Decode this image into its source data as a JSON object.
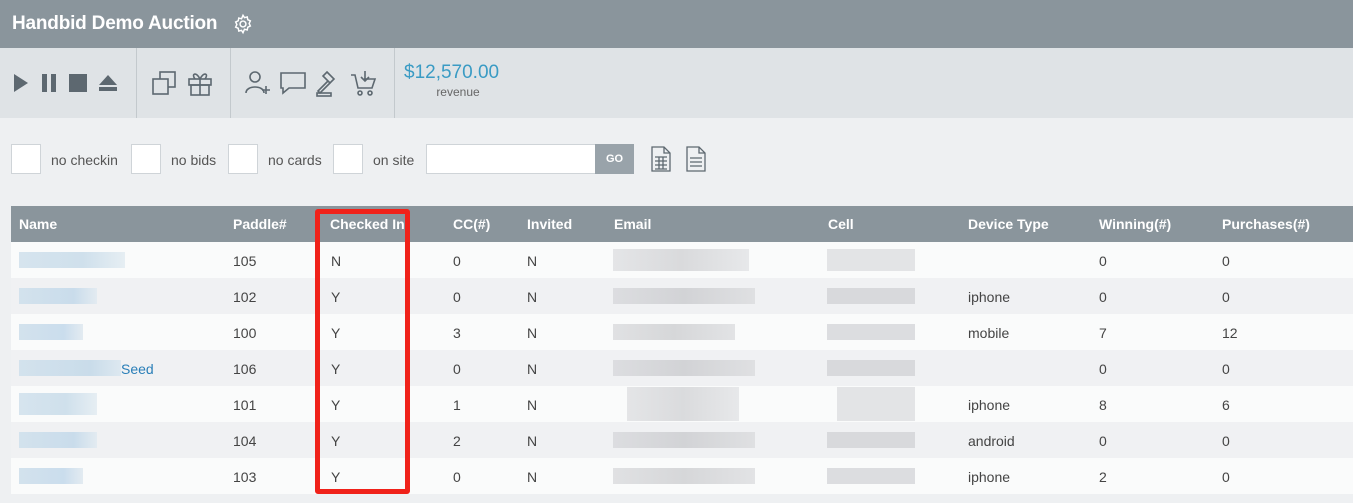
{
  "app": {
    "title": "Handbid Demo Auction",
    "title_icon": "gear-icon"
  },
  "toolbar": {
    "playback_icons": [
      "play-icon",
      "pause-icon",
      "stop-icon",
      "eject-icon"
    ],
    "item_icons": [
      "copy-icon",
      "gift-icon"
    ],
    "action_icons": [
      "add-user-icon",
      "chat-icon",
      "gavel-icon",
      "cart-download-icon"
    ],
    "revenue_amount": "$12,570.00",
    "revenue_label": "revenue",
    "accent_color": "#3a9bc4"
  },
  "filters": {
    "no_checkin": "no checkin",
    "no_bids": "no bids",
    "no_cards": "no cards",
    "on_site": "on site",
    "search_value": "",
    "go_label": "GO",
    "export_icons": [
      "spreadsheet-icon",
      "document-icon"
    ]
  },
  "table": {
    "columns": [
      "Name",
      "Paddle#",
      "Checked In",
      "CC(#)",
      "Invited",
      "Email",
      "Cell",
      "Device Type",
      "Winning(#)",
      "Purchases(#)"
    ],
    "rows": [
      {
        "name_suffix": "",
        "paddle": "105",
        "checked_in": "N",
        "cc": "0",
        "invited": "N",
        "device": "",
        "winning": "0",
        "purchases": "0"
      },
      {
        "name_suffix": "",
        "paddle": "102",
        "checked_in": "Y",
        "cc": "0",
        "invited": "N",
        "device": "iphone",
        "winning": "0",
        "purchases": "0"
      },
      {
        "name_suffix": "",
        "paddle": "100",
        "checked_in": "Y",
        "cc": "3",
        "invited": "N",
        "device": "mobile",
        "winning": "7",
        "purchases": "12"
      },
      {
        "name_suffix": "Seed",
        "paddle": "106",
        "checked_in": "Y",
        "cc": "0",
        "invited": "N",
        "device": "",
        "winning": "0",
        "purchases": "0"
      },
      {
        "name_suffix": "",
        "paddle": "101",
        "checked_in": "Y",
        "cc": "1",
        "invited": "N",
        "device": "iphone",
        "winning": "8",
        "purchases": "6"
      },
      {
        "name_suffix": "",
        "paddle": "104",
        "checked_in": "Y",
        "cc": "2",
        "invited": "N",
        "device": "android",
        "winning": "0",
        "purchases": "0"
      },
      {
        "name_suffix": "",
        "paddle": "103",
        "checked_in": "Y",
        "cc": "0",
        "invited": "N",
        "device": "iphone",
        "winning": "2",
        "purchases": "0"
      }
    ],
    "highlight_color": "#f0221a"
  }
}
